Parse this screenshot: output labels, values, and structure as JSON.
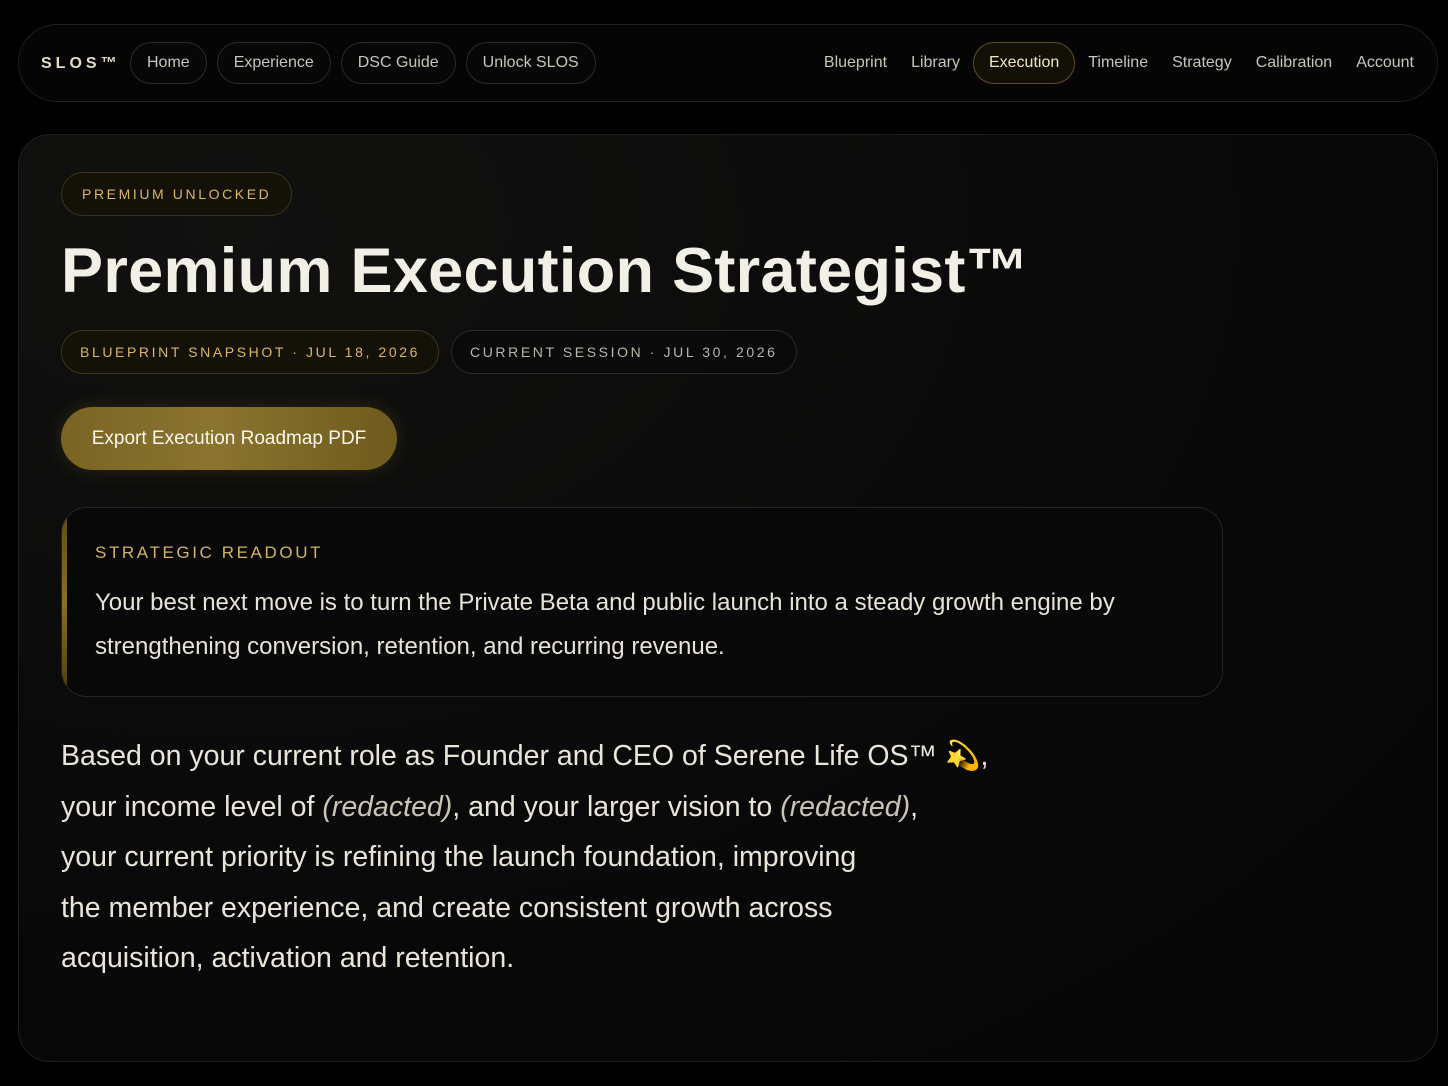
{
  "nav": {
    "brand": "SLOS™",
    "left_pills": [
      {
        "label": "Home"
      },
      {
        "label": "Experience"
      },
      {
        "label": "DSC Guide"
      },
      {
        "label": "Unlock SLOS"
      }
    ],
    "right_links": [
      {
        "label": "Blueprint"
      },
      {
        "label": "Library"
      },
      {
        "label": "Execution"
      },
      {
        "label": "Timeline"
      },
      {
        "label": "Strategy"
      },
      {
        "label": "Calibration"
      },
      {
        "label": "Account"
      }
    ],
    "active": "Execution"
  },
  "page": {
    "badge": "PREMIUM UNLOCKED",
    "title": "Premium Execution Strategist™",
    "blueprint_chip": "BLUEPRINT SNAPSHOT · JUL 18, 2026",
    "session_chip": "CURRENT SESSION · JUL 30, 2026",
    "export_label": "Export Execution Roadmap PDF"
  },
  "readout": {
    "label": "STRATEGIC READOUT",
    "text": "Your best next move is to turn the Private Beta and public launch into a steady growth engine by strengthening conversion, retention, and recurring revenue."
  },
  "summary": {
    "part1": "Based on your current role as Founder and CEO of Serene Life OS™ 💫,",
    "part2": "your income level of ",
    "income": "(redacted)",
    "part3": ", and your larger vision to ",
    "vision": "(redacted)",
    "part4": ",",
    "part5": "your current priority is refining the launch foundation, improving",
    "part6": "the member experience, and create consistent growth across",
    "part7": "acquisition, activation and retention."
  },
  "colors": {
    "accent_gold": "#d8b866",
    "button_gold": "#8b7430",
    "background": "#000000"
  }
}
